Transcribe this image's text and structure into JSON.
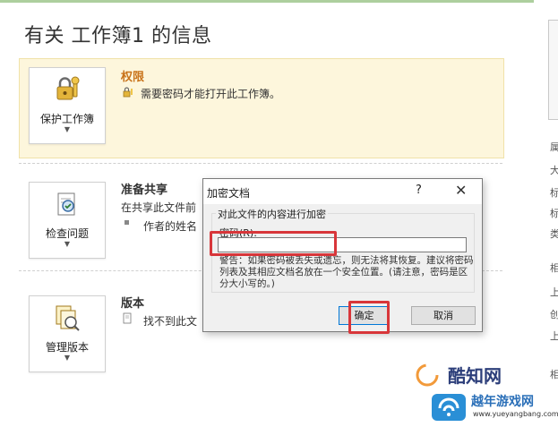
{
  "page": {
    "title": "有关 工作簿1 的信息"
  },
  "permissions": {
    "heading": "权限",
    "text": "需要密码才能打开此工作簿。",
    "button_label": "保护工作簿"
  },
  "share": {
    "heading": "准备共享",
    "text": "在共享此文件前",
    "bullet": "作者的姓名",
    "button_label": "检查问题"
  },
  "versions": {
    "heading": "版本",
    "text": "找不到此文",
    "button_label": "管理版本"
  },
  "dialog": {
    "title": "加密文档",
    "help": "?",
    "close": "✕",
    "group_label": "对此文件的内容进行加密",
    "password_label": "密码(R):",
    "password_value": "",
    "warning": "警告：如果密码被丢失或遗忘，则无法将其恢复。建议将密码列表及其相应文档名放在一个安全位置。(请注意，密码是区分大小写的。)",
    "ok_label": "确定",
    "cancel_label": "取消"
  },
  "right_panel": {
    "chars": [
      "属",
      "大",
      "标",
      "标",
      "类",
      "相",
      "上",
      "创",
      "上",
      "相"
    ]
  },
  "watermark": {
    "brand1": "酷知网",
    "brand2": "越年游戏网",
    "url": "www.yueyangbang.com"
  },
  "colors": {
    "highlight": "#d8363a",
    "permissions_bg": "#fdf6dc",
    "accent_blue": "#0078d7"
  }
}
